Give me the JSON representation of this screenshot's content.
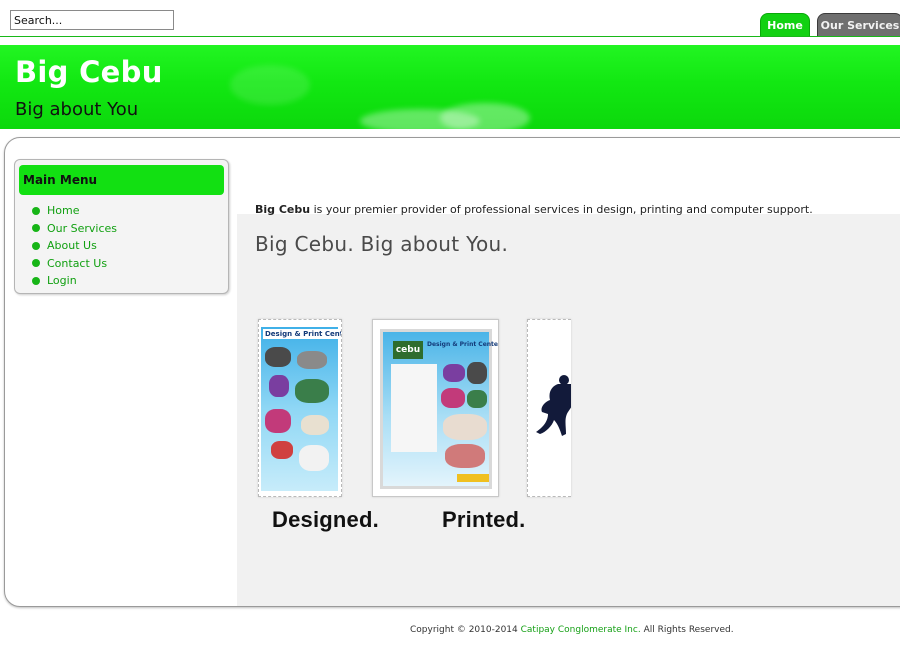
{
  "search": {
    "placeholder": "Search..."
  },
  "tabs": [
    {
      "label": "Home",
      "active": true
    },
    {
      "label": "Our Services",
      "active": false
    }
  ],
  "banner": {
    "title": "Big Cebu",
    "subtitle": "Big about You"
  },
  "menu": {
    "title": "Main Menu",
    "items": [
      {
        "label": "Home"
      },
      {
        "label": "Our Services"
      },
      {
        "label": "About Us"
      },
      {
        "label": "Contact Us"
      },
      {
        "label": "Login"
      }
    ]
  },
  "content": {
    "intro_bold": "Big Cebu",
    "intro_rest": " is your premier provider of professional services in design, printing and computer support.",
    "heading": "Big Cebu. Big about You.",
    "brochure_title": "Design & Print Center",
    "brochure_logo": "cebu",
    "caption_designed": "Designed.",
    "caption_printed": "Printed."
  },
  "footer": {
    "prefix": "Copyright © 2010-2014 ",
    "company": "Catipay Conglomerate Inc.",
    "suffix": " All Rights Reserved."
  },
  "colors": {
    "accent": "#12e012",
    "link": "#11a011",
    "tab_inactive": "#6f6f6f"
  }
}
